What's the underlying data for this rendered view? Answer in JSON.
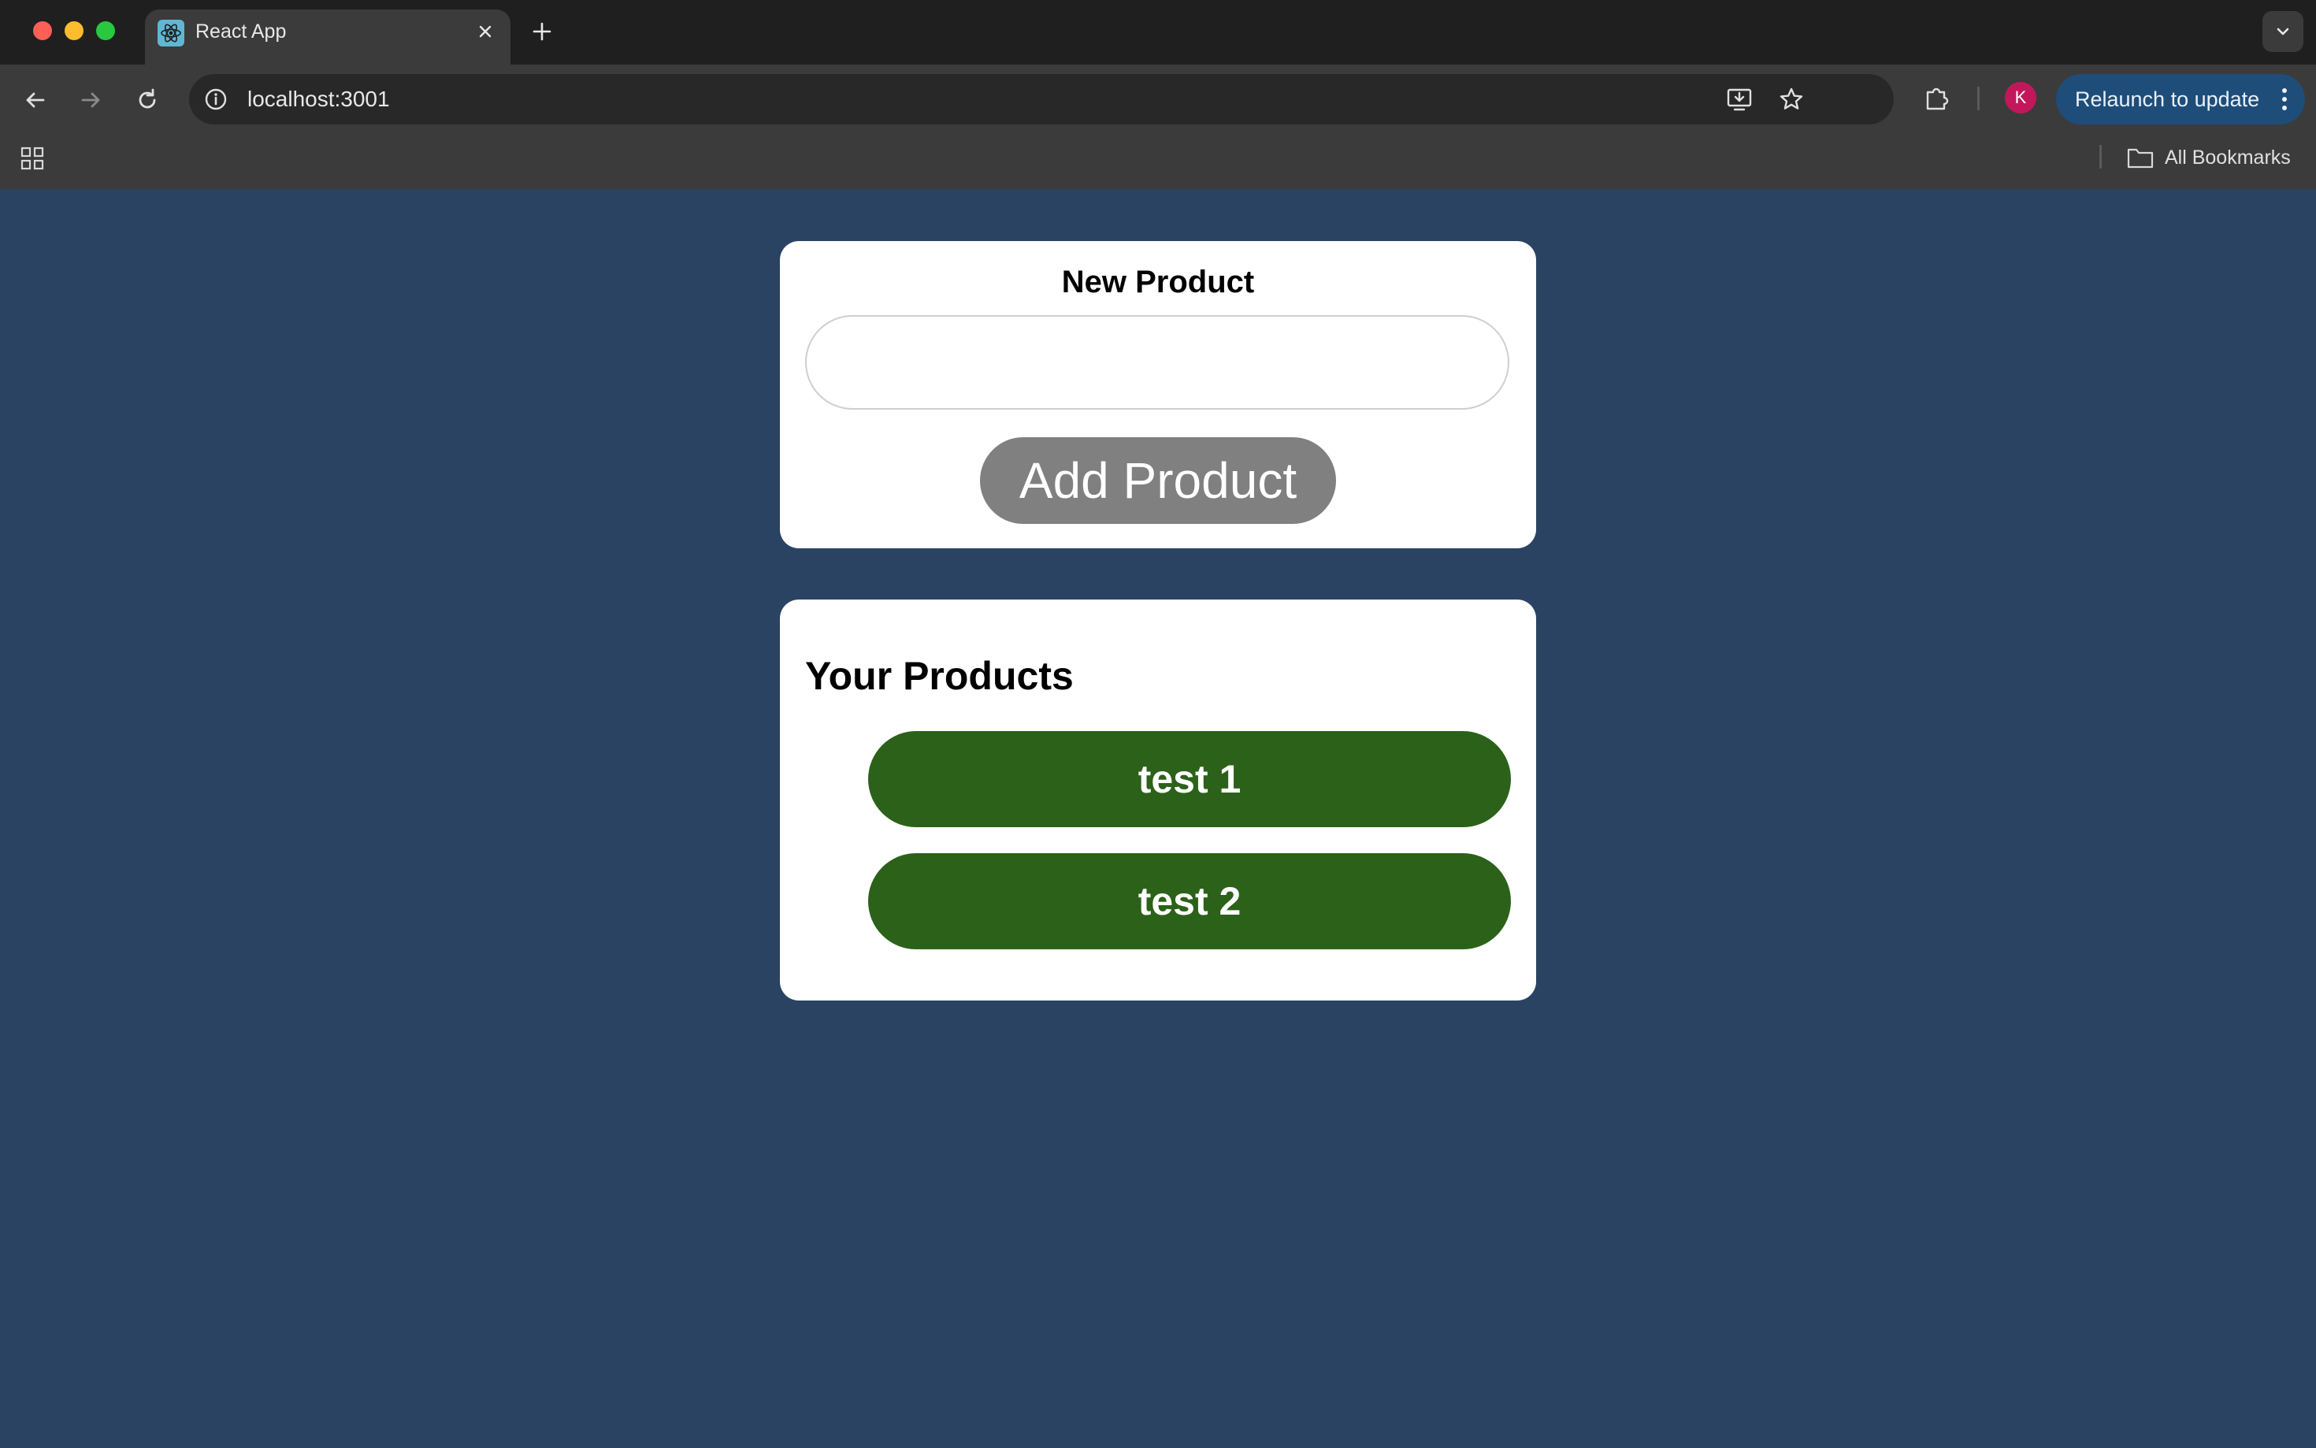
{
  "browser": {
    "tab": {
      "title": "React App",
      "favicon": "react-logo-icon"
    },
    "address": {
      "url": "localhost:3001"
    },
    "relaunch_label": "Relaunch to update",
    "profile_initial": "K",
    "bookmarks": {
      "all_label": "All Bookmarks"
    }
  },
  "new_product": {
    "title": "New Product",
    "input_value": "",
    "add_label": "Add Product"
  },
  "products": {
    "title": "Your Products",
    "items": [
      {
        "name": "test 1"
      },
      {
        "name": "test 2"
      }
    ]
  },
  "colors": {
    "page_background": "#2a4362",
    "product_item": "#2c6119",
    "add_button": "#808080"
  }
}
